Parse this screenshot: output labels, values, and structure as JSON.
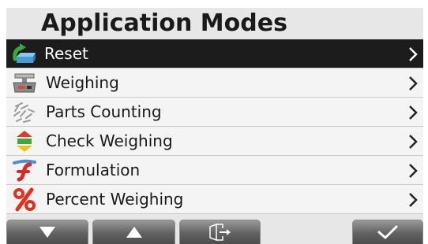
{
  "title": "Application Modes",
  "menu": {
    "items": [
      {
        "label": "Reset",
        "icon": "reset-icon",
        "selected": true
      },
      {
        "label": "Weighing",
        "icon": "scale-icon",
        "selected": false
      },
      {
        "label": "Parts Counting",
        "icon": "parts-icon",
        "selected": false
      },
      {
        "label": "Check Weighing",
        "icon": "check-weighing-icon",
        "selected": false
      },
      {
        "label": "Formulation",
        "icon": "formulation-icon",
        "selected": false
      },
      {
        "label": "Percent Weighing",
        "icon": "percent-icon",
        "selected": false
      }
    ]
  },
  "toolbar": {
    "buttons": [
      {
        "icon": "arrow-down-icon"
      },
      {
        "icon": "arrow-up-icon"
      },
      {
        "icon": "exit-icon"
      },
      {
        "icon": "checkmark-icon"
      }
    ]
  },
  "colors": {
    "background": "#e7e7e7",
    "row": "#f4f4f4",
    "selected_row": "#1c1c1c",
    "button": "#616161"
  }
}
